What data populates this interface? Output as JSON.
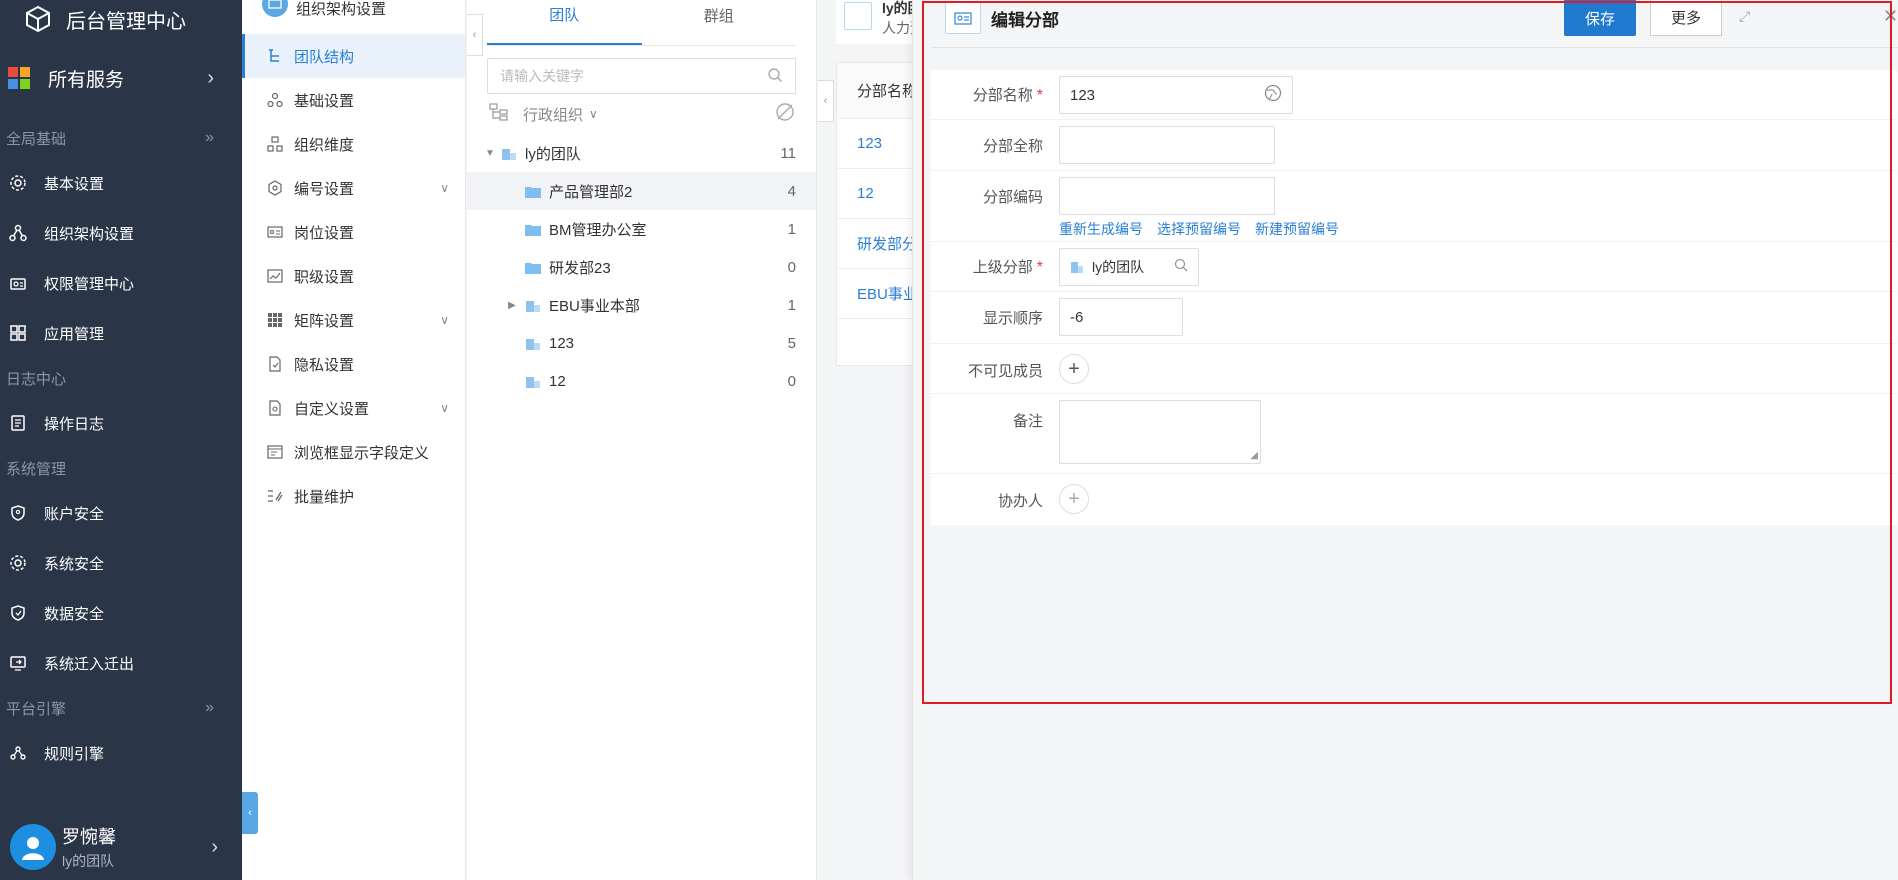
{
  "app": {
    "title": "后台管理中心"
  },
  "sidebar": {
    "all_services": "所有服务",
    "groups": [
      {
        "label": "全局基础",
        "items": [
          {
            "label": "基本设置",
            "icon": "gear-icon"
          },
          {
            "label": "组织架构设置",
            "icon": "org-icon"
          },
          {
            "label": "权限管理中心",
            "icon": "permission-icon"
          },
          {
            "label": "应用管理",
            "icon": "apps-icon"
          }
        ]
      },
      {
        "label": "日志中心",
        "items": [
          {
            "label": "操作日志",
            "icon": "log-icon"
          }
        ]
      },
      {
        "label": "系统管理",
        "items": [
          {
            "label": "账户安全",
            "icon": "shield-icon"
          },
          {
            "label": "系统安全",
            "icon": "gear-icon"
          },
          {
            "label": "数据安全",
            "icon": "shield-icon"
          },
          {
            "label": "系统迁入迁出",
            "icon": "migrate-icon"
          }
        ]
      },
      {
        "label": "平台引擎",
        "items": [
          {
            "label": "规则引擎",
            "icon": "rule-icon"
          }
        ]
      }
    ],
    "user": {
      "name": "罗惋馨",
      "team": "ly的团队"
    }
  },
  "nav2": {
    "header": "组织架构设置",
    "items": [
      {
        "label": "团队结构",
        "active": true
      },
      {
        "label": "基础设置"
      },
      {
        "label": "组织维度"
      },
      {
        "label": "编号设置",
        "expandable": true
      },
      {
        "label": "岗位设置"
      },
      {
        "label": "职级设置"
      },
      {
        "label": "矩阵设置",
        "expandable": true
      },
      {
        "label": "隐私设置"
      },
      {
        "label": "自定义设置",
        "expandable": true
      },
      {
        "label": "浏览框显示字段定义"
      },
      {
        "label": "批量维护"
      }
    ]
  },
  "tree": {
    "tabs": [
      "团队",
      "群组"
    ],
    "search_placeholder": "请输入关键字",
    "org_type": "行政组织",
    "nodes": [
      {
        "label": "ly的团队",
        "count": "11",
        "level": 0,
        "expanded": true,
        "type": "company"
      },
      {
        "label": "产品管理部2",
        "count": "4",
        "level": 1,
        "type": "folder",
        "selected": true
      },
      {
        "label": "BM管理办公室",
        "count": "1",
        "level": 1,
        "type": "folder"
      },
      {
        "label": "研发部23",
        "count": "0",
        "level": 1,
        "type": "folder"
      },
      {
        "label": "EBU事业本部",
        "count": "1",
        "level": 1,
        "type": "company",
        "collapsed": true
      },
      {
        "label": "123",
        "count": "5",
        "level": 1,
        "type": "company"
      },
      {
        "label": "12",
        "count": "0",
        "level": 1,
        "type": "company"
      }
    ]
  },
  "list": {
    "title": "ly的团",
    "subtitle": "人力资",
    "column": "分部名称",
    "rows": [
      "123",
      "12",
      "研发部分",
      "EBU事业"
    ]
  },
  "drawer": {
    "title": "编辑分部",
    "save": "保存",
    "more": "更多",
    "fields": {
      "name_label": "分部名称",
      "name_value": "123",
      "fullname_label": "分部全称",
      "fullname_value": "",
      "code_label": "分部编码",
      "code_value": "",
      "code_links": [
        "重新生成编号",
        "选择预留编号",
        "新建预留编号"
      ],
      "parent_label": "上级分部",
      "parent_value": "ly的团队",
      "order_label": "显示顺序",
      "order_value": "-6",
      "invisible_label": "不可见成员",
      "remark_label": "备注",
      "assist_label": "协办人"
    }
  },
  "colors": {
    "sidebar": "#2a3548",
    "accent": "#1f7ad0",
    "required": "#e63c3c",
    "highlight_box": "#e01b24"
  }
}
